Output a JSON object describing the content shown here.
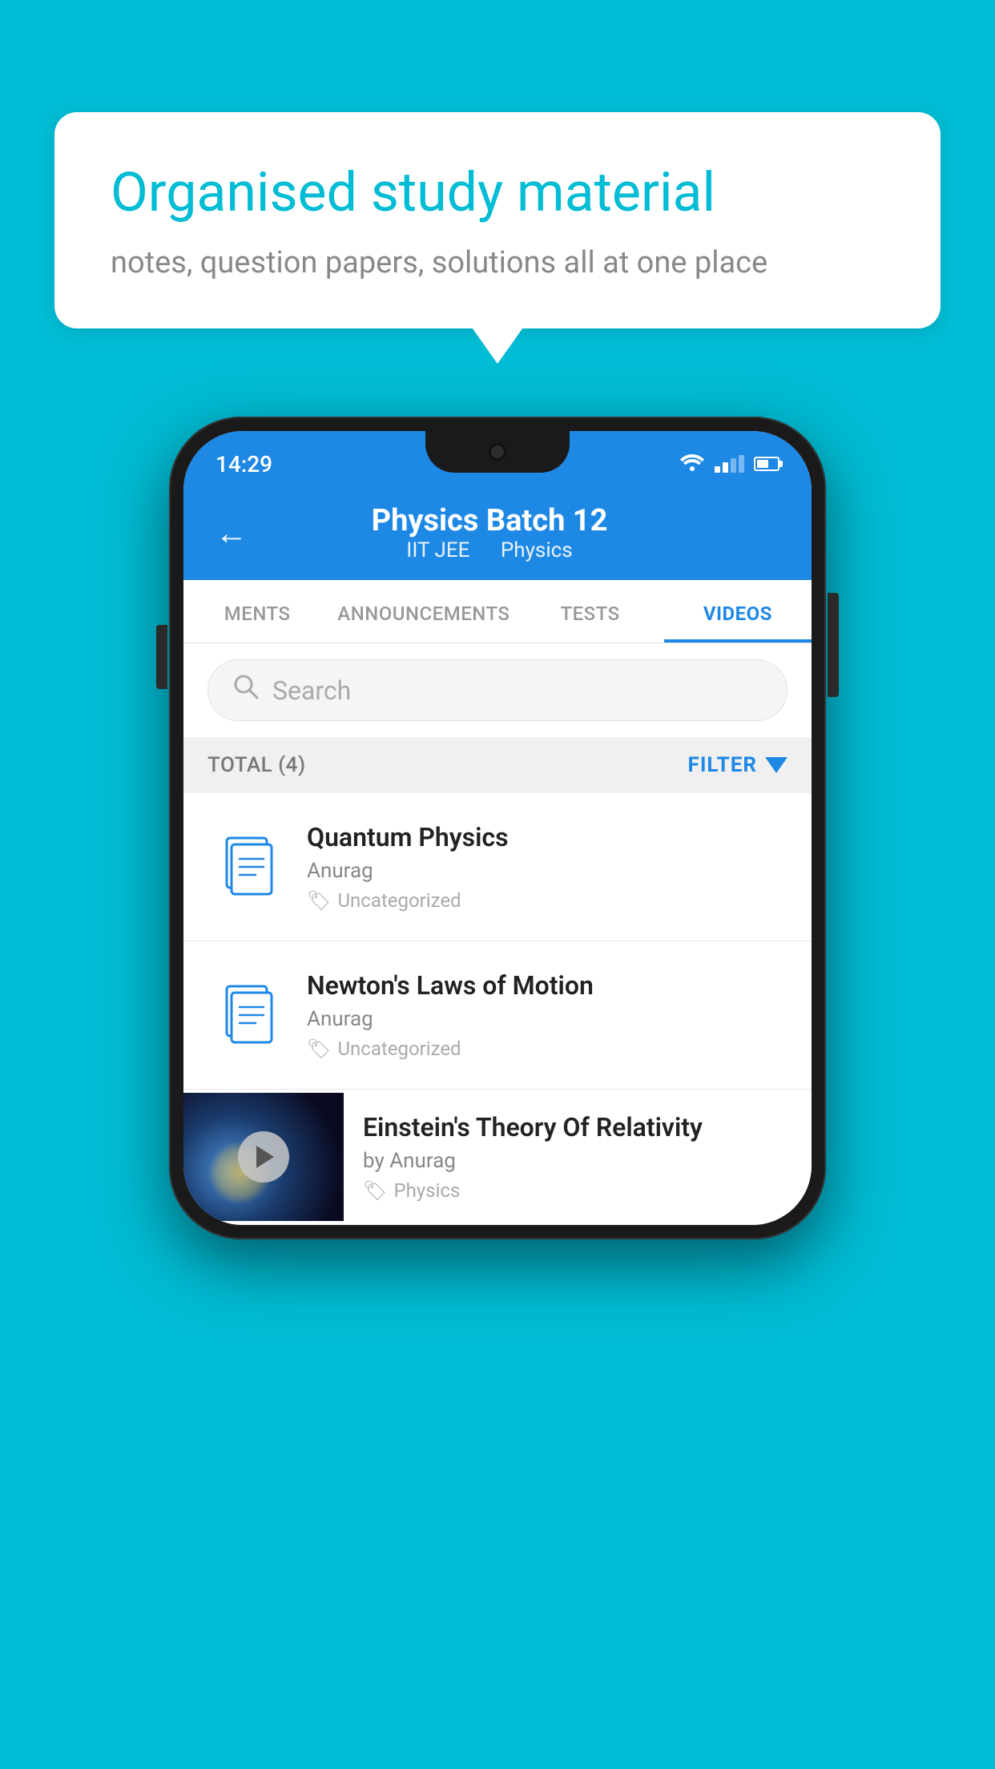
{
  "background": {
    "color": "#00BCD4"
  },
  "speech_bubble": {
    "title": "Organised study material",
    "subtitle": "notes, question papers, solutions all at one place"
  },
  "phone": {
    "status_bar": {
      "time": "14:29",
      "wifi": true,
      "signal": true,
      "battery": true
    },
    "header": {
      "back_label": "←",
      "title": "Physics Batch 12",
      "subtitle_left": "IIT JEE",
      "subtitle_right": "Physics"
    },
    "tabs": [
      {
        "label": "MENTS",
        "active": false
      },
      {
        "label": "ANNOUNCEMENTS",
        "active": false
      },
      {
        "label": "TESTS",
        "active": false
      },
      {
        "label": "VIDEOS",
        "active": true
      }
    ],
    "search": {
      "placeholder": "Search"
    },
    "filter_row": {
      "total_label": "TOTAL (4)",
      "filter_label": "FILTER"
    },
    "videos": [
      {
        "id": 1,
        "title": "Quantum Physics",
        "author": "Anurag",
        "tag": "Uncategorized",
        "type": "document",
        "has_thumbnail": false
      },
      {
        "id": 2,
        "title": "Newton's Laws of Motion",
        "author": "Anurag",
        "tag": "Uncategorized",
        "type": "document",
        "has_thumbnail": false
      },
      {
        "id": 3,
        "title": "Einstein's Theory Of Relativity",
        "author": "by Anurag",
        "tag": "Physics",
        "type": "video",
        "has_thumbnail": true
      }
    ]
  }
}
